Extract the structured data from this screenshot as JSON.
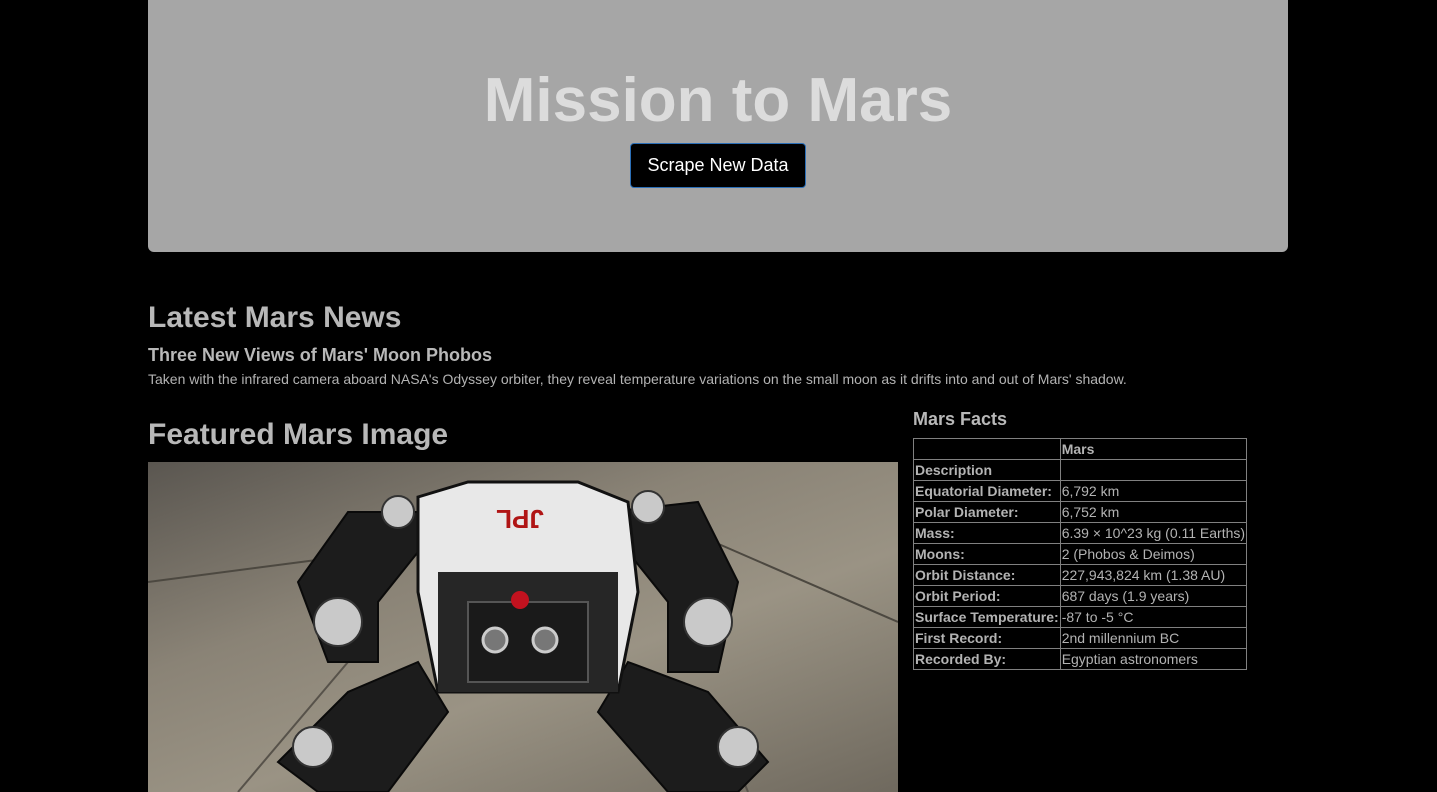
{
  "jumbotron": {
    "title": "Mission to Mars",
    "button_label": "Scrape New Data"
  },
  "news": {
    "heading": "Latest Mars News",
    "title": "Three New Views of Mars' Moon Phobos",
    "paragraph": "Taken with the infrared camera aboard NASA's Odyssey orbiter, they reveal temperature variations on the small moon as it drifts into and out of Mars' shadow."
  },
  "featured": {
    "heading": "Featured Mars Image",
    "image_alt": "JPL robot",
    "logo_text": "JPL"
  },
  "facts": {
    "heading": "Mars Facts",
    "column_header": "Mars",
    "rows": [
      {
        "label": "Description",
        "value": ""
      },
      {
        "label": "Equatorial Diameter:",
        "value": "6,792 km"
      },
      {
        "label": "Polar Diameter:",
        "value": "6,752 km"
      },
      {
        "label": "Mass:",
        "value": "6.39 × 10^23 kg (0.11 Earths)"
      },
      {
        "label": "Moons:",
        "value": "2 (Phobos & Deimos)"
      },
      {
        "label": "Orbit Distance:",
        "value": "227,943,824 km (1.38 AU)"
      },
      {
        "label": "Orbit Period:",
        "value": "687 days (1.9 years)"
      },
      {
        "label": "Surface Temperature:",
        "value": "-87 to -5 °C"
      },
      {
        "label": "First Record:",
        "value": "2nd millennium BC"
      },
      {
        "label": "Recorded By:",
        "value": "Egyptian astronomers"
      }
    ]
  },
  "colors": {
    "background": "#000000",
    "jumbotron": "#a6a6a6",
    "button_border": "#2b6fb8"
  }
}
